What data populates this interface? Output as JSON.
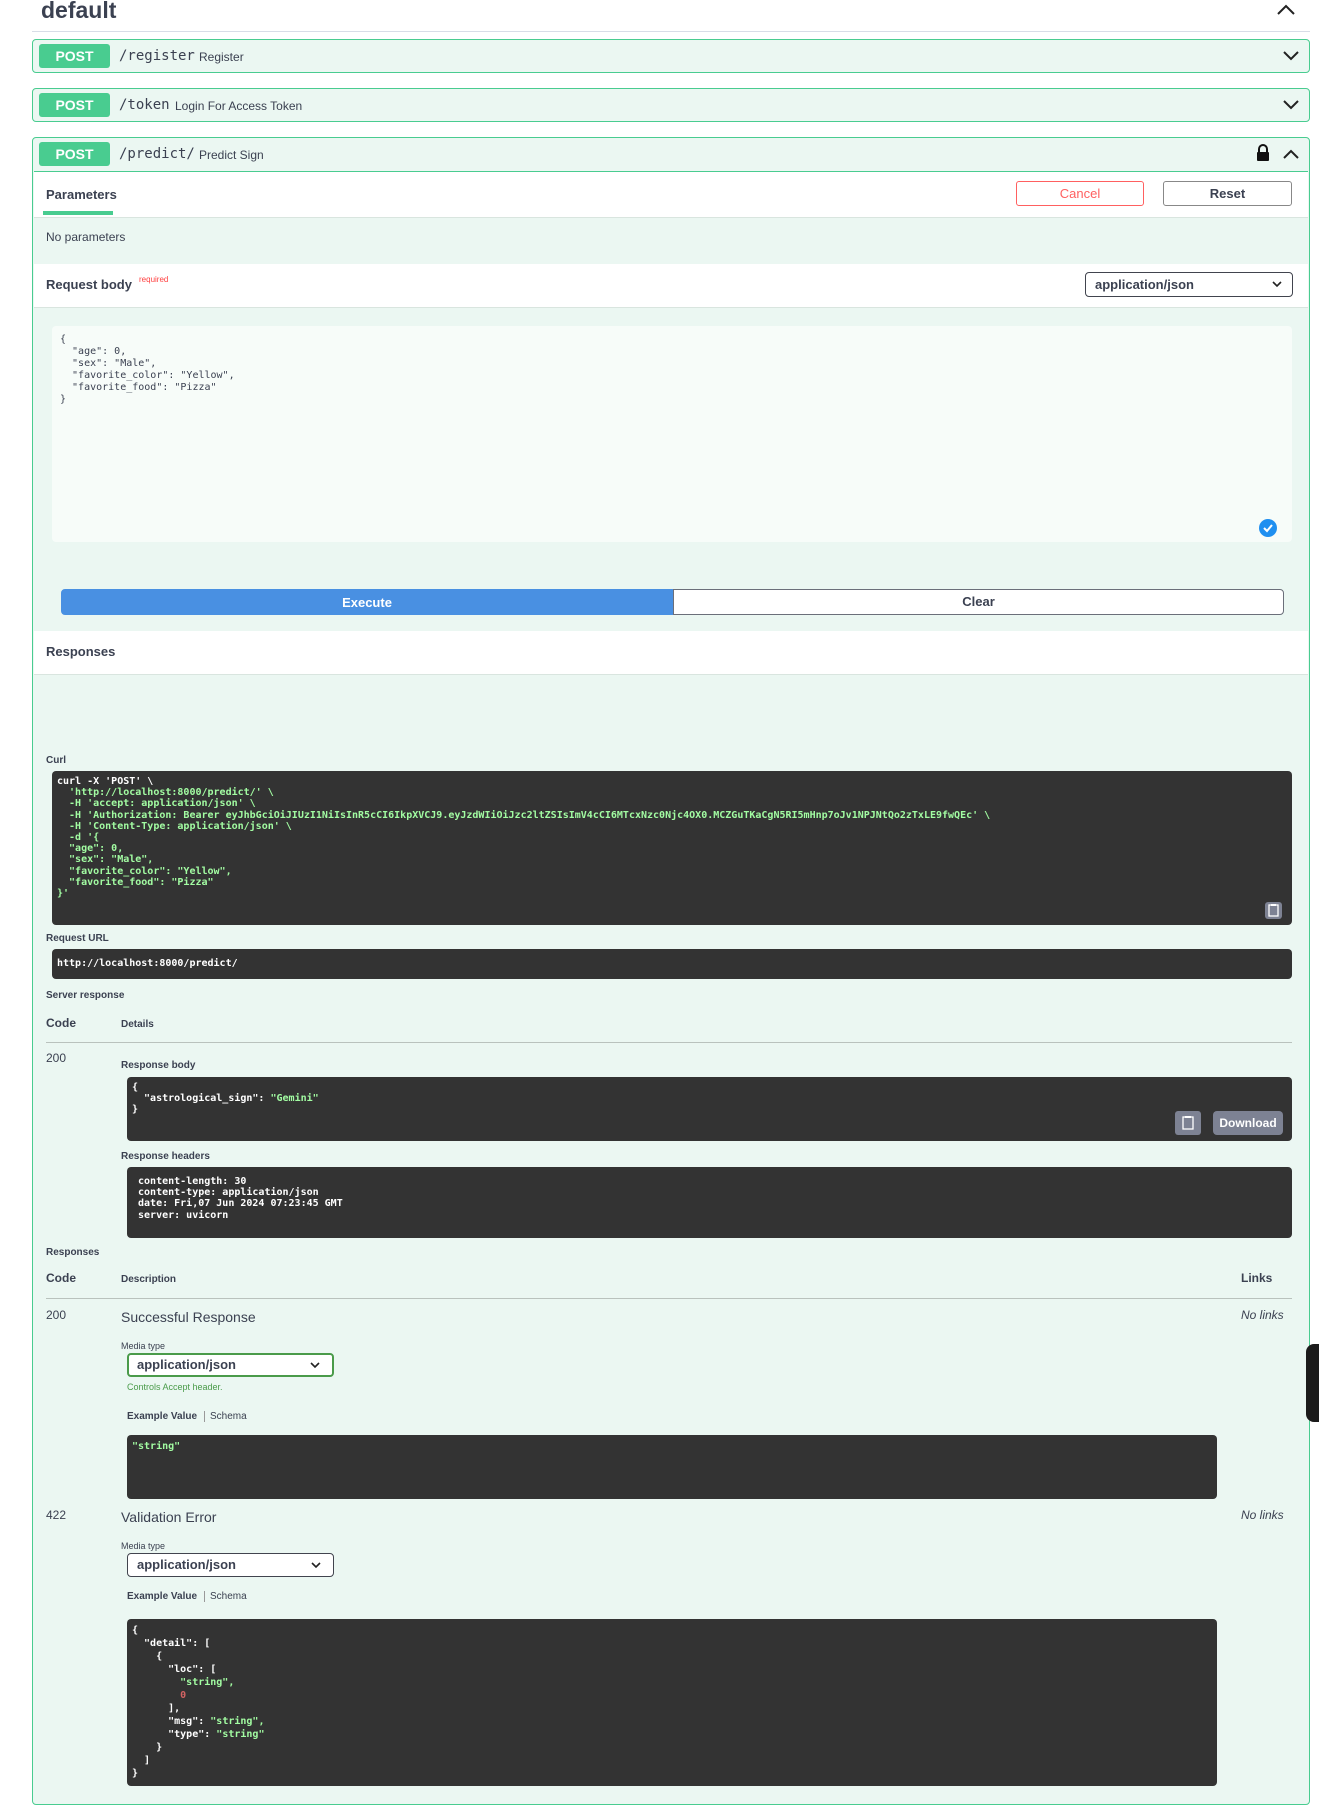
{
  "tag": {
    "title": "default"
  },
  "operations": [
    {
      "method": "POST",
      "path": "/register",
      "summary": "Register"
    },
    {
      "method": "POST",
      "path": "/token",
      "summary": "Login For Access Token"
    },
    {
      "method": "POST",
      "path": "/predict/",
      "summary": "Predict Sign"
    }
  ],
  "parameters": {
    "tab_label": "Parameters",
    "cancel_label": "Cancel",
    "reset_label": "Reset",
    "no_params_text": "No parameters"
  },
  "request_body": {
    "title": "Request body",
    "required_label": "required",
    "content_type": "application/json",
    "body_text": "{\n  \"age\": 0,\n  \"sex\": \"Male\",\n  \"favorite_color\": \"Yellow\",\n  \"favorite_food\": \"Pizza\"\n}"
  },
  "actions": {
    "execute_label": "Execute",
    "clear_label": "Clear"
  },
  "responses_section": {
    "title": "Responses",
    "curl_label": "Curl",
    "curl_lines": [
      "curl -X 'POST' \\",
      "  'http://localhost:8000/predict/' \\",
      "  -H 'accept: application/json' \\",
      "  -H 'Authorization: Bearer eyJhbGciOiJIUzI1NiIsInR5cCI6IkpXVCJ9.eyJzdWIiOiJzc2ltZSIsImV4cCI6MTcxNzc0Njc4OX0.MCZGuTKaCgN5RI5mHnp7oJv1NPJNtQo2zTxLE9fwQEc' \\",
      "  -H 'Content-Type: application/json' \\",
      "  -d '{",
      "  \"age\": 0,",
      "  \"sex\": \"Male\",",
      "  \"favorite_color\": \"Yellow\",",
      "  \"favorite_food\": \"Pizza\"",
      "}'"
    ],
    "request_url_label": "Request URL",
    "request_url": "http://localhost:8000/predict/",
    "server_response_label": "Server response",
    "code_header": "Code",
    "details_header": "Details",
    "server_code": "200",
    "response_body_label": "Response body",
    "response_body_open": "{",
    "response_body_key": "  \"astrological_sign\": ",
    "response_body_value": "\"Gemini\"",
    "response_body_close": "}",
    "download_label": "Download",
    "response_headers_label": "Response headers",
    "response_headers_text": " content-length: 30 \n content-type: application/json \n date: Fri,07 Jun 2024 07:23:45 GMT \n server: uvicorn "
  },
  "documented_responses": {
    "title": "Responses",
    "code_header": "Code",
    "description_header": "Description",
    "links_header": "Links",
    "items": [
      {
        "code": "200",
        "description": "Successful Response",
        "links": "No links",
        "media_type_label": "Media type",
        "media_type": "application/json",
        "controls_text": "Controls Accept header.",
        "example_tab": "Example Value",
        "schema_tab": "Schema",
        "example": "\"string\""
      },
      {
        "code": "422",
        "description": "Validation Error",
        "links": "No links",
        "media_type_label": "Media type",
        "media_type": "application/json",
        "example_tab": "Example Value",
        "schema_tab": "Schema"
      }
    ]
  },
  "colors": {
    "post_green": "#49cc90",
    "panel_bg": "#ebf7f2",
    "execute_blue": "#4990e2",
    "cancel_red": "#ff6060",
    "code_bg": "#333333",
    "code_string": "#a2fca2"
  },
  "icons": [
    "chevron-up-icon",
    "chevron-down-icon",
    "lock-icon",
    "copy-icon",
    "valid-check-icon"
  ]
}
